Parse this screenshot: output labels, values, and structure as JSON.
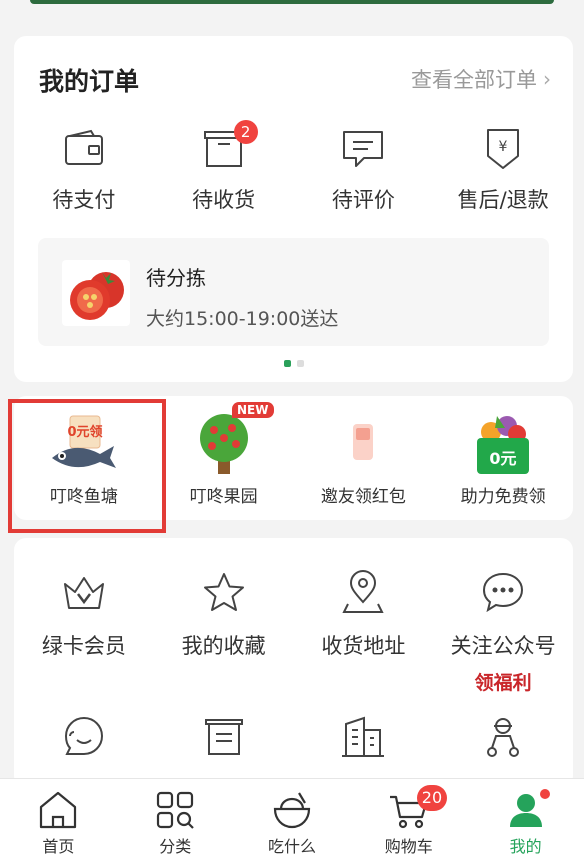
{
  "orders": {
    "title": "我的订单",
    "see_all": "查看全部订单",
    "items": [
      {
        "label": "待支付",
        "icon": "wallet-icon"
      },
      {
        "label": "待收货",
        "icon": "box-icon",
        "badge": "2"
      },
      {
        "label": "待评价",
        "icon": "comment-icon"
      },
      {
        "label": "售后/退款",
        "icon": "refund-icon"
      }
    ],
    "pending": {
      "title": "待分拣",
      "subtitle": "大约15:00-19:00送达",
      "image": "tomato-image"
    },
    "pager": {
      "count": 2,
      "active": 0
    }
  },
  "promos": [
    {
      "label": "叮咚鱼塘",
      "icon": "fish-pond-icon",
      "pic_text": "0元领"
    },
    {
      "label": "叮咚果园",
      "icon": "fruit-tree-icon",
      "tag": "NEW"
    },
    {
      "label": "邀友领红包",
      "icon": "red-envelope-icon"
    },
    {
      "label": "助力免费领",
      "icon": "free-basket-icon",
      "pic_text": "0元"
    }
  ],
  "services": {
    "row1": [
      {
        "label": "绿卡会员",
        "icon": "crown-icon"
      },
      {
        "label": "我的收藏",
        "icon": "star-icon"
      },
      {
        "label": "收货地址",
        "icon": "location-icon"
      },
      {
        "label": "关注公众号",
        "icon": "chat-icon",
        "sub": "领福利"
      }
    ],
    "row2": [
      {
        "icon": "customer-service-icon"
      },
      {
        "icon": "notice-icon"
      },
      {
        "icon": "building-icon"
      },
      {
        "icon": "delivery-rider-icon"
      }
    ]
  },
  "tabbar": [
    {
      "label": "首页",
      "icon": "home-icon"
    },
    {
      "label": "分类",
      "icon": "category-icon"
    },
    {
      "label": "吃什么",
      "icon": "bowl-icon"
    },
    {
      "label": "购物车",
      "icon": "cart-icon",
      "badge": "20"
    },
    {
      "label": "我的",
      "icon": "profile-icon",
      "active": true
    }
  ],
  "colors": {
    "accent": "#25a35b",
    "badge": "#f0433f",
    "highlight": "#e23b36",
    "promo_red": "#c9262a"
  }
}
